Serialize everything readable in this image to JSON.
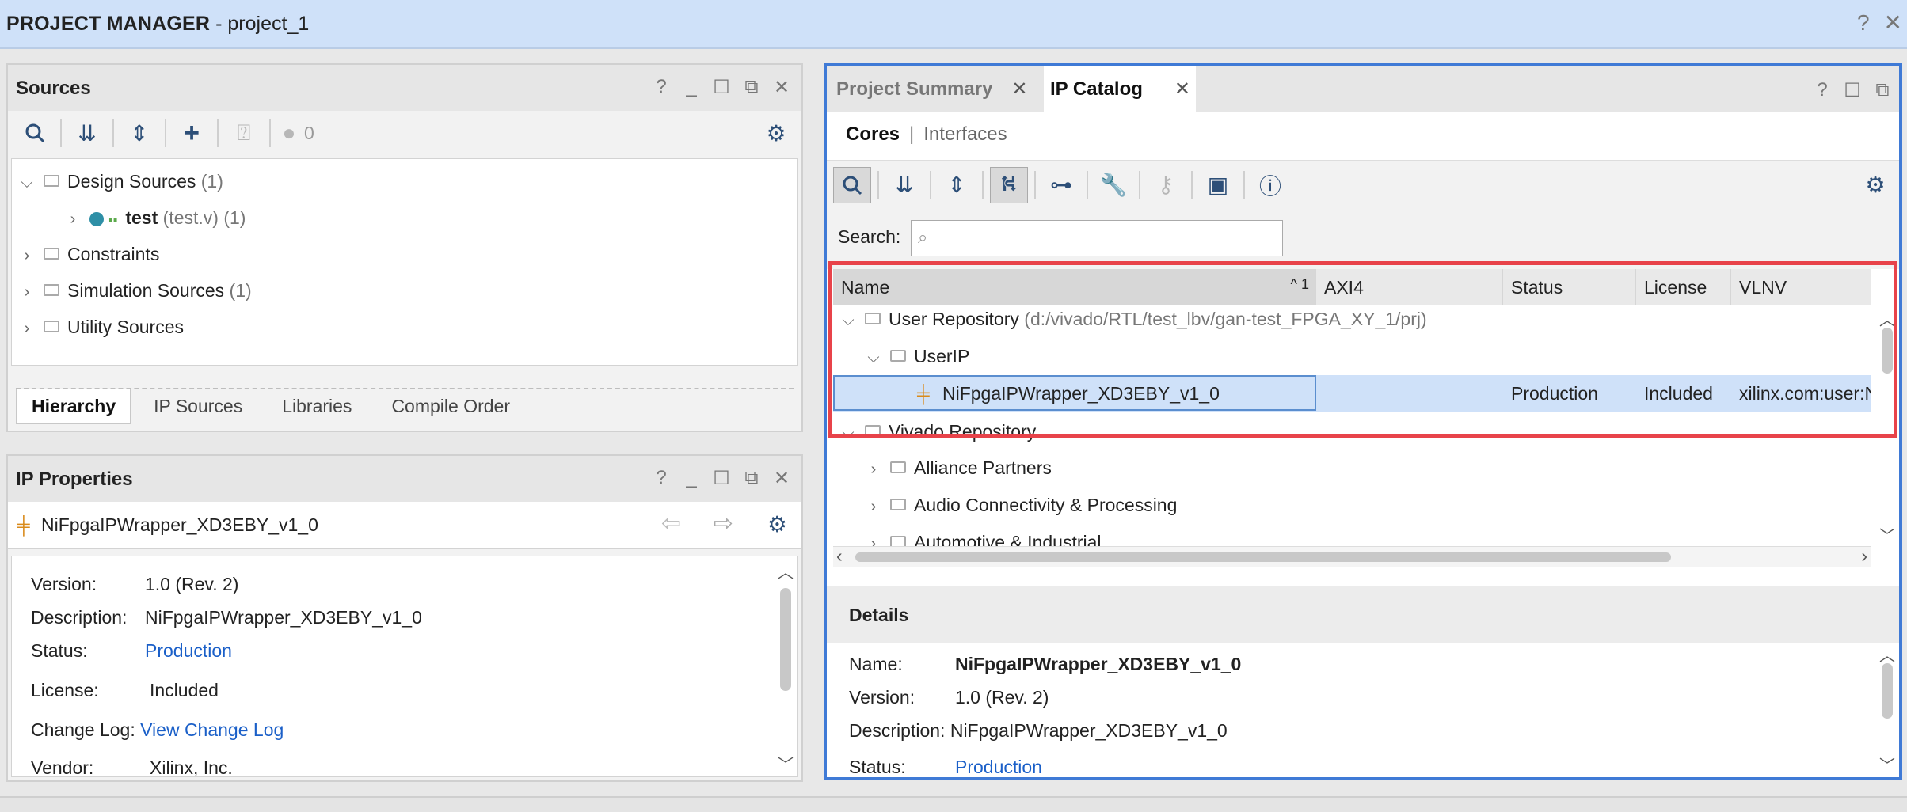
{
  "window": {
    "title_bold": "PROJECT MANAGER",
    "title_rest": " - project_1"
  },
  "sources": {
    "title": "Sources",
    "badge_count": "0",
    "tree": {
      "design": {
        "label": "Design Sources",
        "count": "(1)"
      },
      "test": {
        "label": "test",
        "file": "(test.v)",
        "count": "(1)"
      },
      "constraints": {
        "label": "Constraints"
      },
      "sim": {
        "label": "Simulation Sources",
        "count": "(1)"
      },
      "utility": {
        "label": "Utility Sources"
      }
    },
    "tabs": [
      "Hierarchy",
      "IP Sources",
      "Libraries",
      "Compile Order"
    ]
  },
  "ip_properties": {
    "title": "IP Properties",
    "selected": "NiFpgaIPWrapper_XD3EBY_v1_0",
    "rows": {
      "version": {
        "k": "Version:",
        "v": "1.0 (Rev. 2)"
      },
      "description": {
        "k": "Description:",
        "v": "NiFpgaIPWrapper_XD3EBY_v1_0"
      },
      "status": {
        "k": "Status:",
        "v": "Production"
      },
      "license": {
        "k": "License:",
        "v": "Included"
      },
      "changelog": {
        "k": "Change Log:",
        "v": "View Change Log"
      },
      "vendor": {
        "k": "Vendor:",
        "v": "Xilinx, Inc."
      }
    }
  },
  "ip_catalog": {
    "tabs": {
      "summary": "Project Summary",
      "catalog": "IP Catalog"
    },
    "subtabs": {
      "cores": "Cores",
      "sep": "|",
      "interfaces": "Interfaces"
    },
    "search_label": "Search:",
    "columns": {
      "name": "Name",
      "sort": "1",
      "axi4": "AXI4",
      "status": "Status",
      "license": "License",
      "vlnv": "VLNV"
    },
    "rows": {
      "user_repo": {
        "label": "User Repository",
        "path": "(d:/vivado/RTL/test_lbv/gan-test_FPGA_XY_1/prj)"
      },
      "userip": {
        "label": "UserIP"
      },
      "ip": {
        "label": "NiFpgaIPWrapper_XD3EBY_v1_0",
        "status": "Production",
        "license": "Included",
        "vlnv": "xilinx.com:user:N"
      },
      "vivado_repo": {
        "label": "Vivado Repository"
      },
      "alliance": {
        "label": "Alliance Partners"
      },
      "audio": {
        "label": "Audio Connectivity & Processing"
      },
      "auto": {
        "label": "Automotive & Industrial"
      }
    },
    "details": {
      "title": "Details",
      "name": {
        "k": "Name:",
        "v": "NiFpgaIPWrapper_XD3EBY_v1_0"
      },
      "version": {
        "k": "Version:",
        "v": "1.0 (Rev. 2)"
      },
      "description": {
        "k": "Description:",
        "v": "NiFpgaIPWrapper_XD3EBY_v1_0"
      },
      "status": {
        "k": "Status:",
        "v": "Production"
      }
    }
  },
  "colors": {
    "accent_blue": "#3f7ad6",
    "highlight_red": "#e8434a",
    "link": "#1a5fc8",
    "selection": "#cfe1f9"
  }
}
